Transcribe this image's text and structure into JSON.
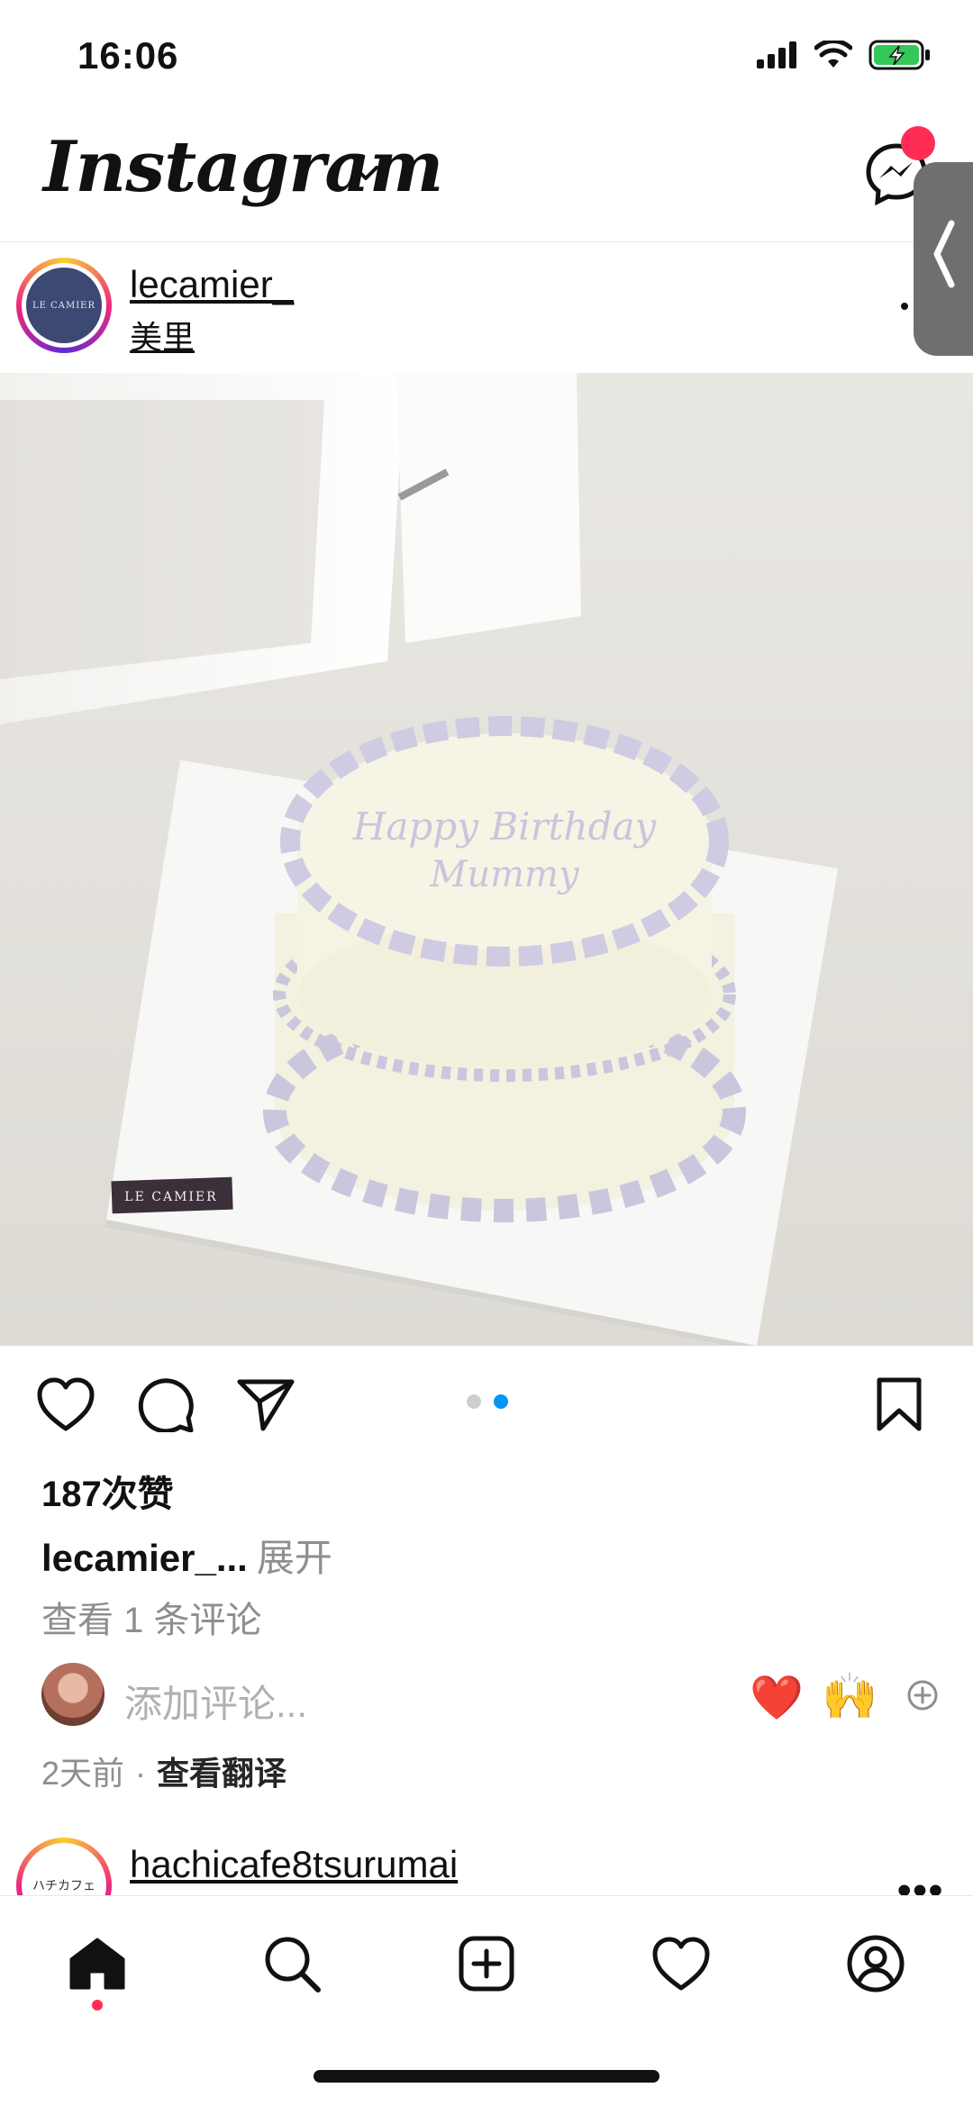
{
  "status_bar": {
    "time": "16:06"
  },
  "header": {
    "logo_text": "Instagram"
  },
  "post": {
    "username": "lecamier_",
    "location": "美里",
    "avatar_text": "LE CAMIER",
    "image": {
      "cake_text_line1": "Happy Birthday",
      "cake_text_line2": "Mummy",
      "board_label": "LE CAMIER"
    },
    "carousel": {
      "total": 2,
      "current": 2
    },
    "likes": "187次赞",
    "caption_user": "lecamier_...",
    "caption_more": "展开",
    "view_comments": "查看 1 条评论",
    "add_comment_placeholder": "添加评论...",
    "quick_reactions": [
      "❤️",
      "🙌"
    ],
    "time_ago": "2天前",
    "separator": "·",
    "translate": "查看翻译"
  },
  "next_post": {
    "username": "hachicafe8tsurumai",
    "avatar_text": "ハチカフェ"
  },
  "bottom_nav": {
    "items": [
      "home-icon",
      "search-icon",
      "create-icon",
      "activity-icon",
      "profile-icon"
    ],
    "active": "home-icon"
  },
  "colors": {
    "accent_blue": "#0095f6",
    "notification_red": "#ff2d55",
    "muted": "#8e8e8e"
  }
}
